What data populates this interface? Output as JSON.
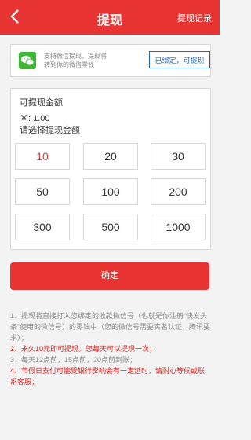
{
  "header": {
    "title": "提现",
    "record_label": "提现记录"
  },
  "wechat": {
    "info_line1": "支持微信提现，提现将",
    "info_line2": "转到你的微信零钱",
    "bound_button": "已绑定，可提现"
  },
  "withdraw": {
    "available_label": "可提现金额",
    "amount": "￥: 1.00",
    "select_label": "请选择提现金额"
  },
  "options": [
    "10",
    "20",
    "30",
    "50",
    "100",
    "200",
    "300",
    "500",
    "1000"
  ],
  "confirm_label": "确定",
  "notes": [
    "1、提现将直接打入您绑定的收款微信号（也就是你注册“快发头条”使用的微信号）的零钱中（您的微信号需要实名认证，腾讯要求）；",
    "2、永久10元即可提现。您每天可以提现一次；",
    "3、每天12点前，15点前，20点前到账；",
    "4、节假日支付可能受银行影响会有一定延时，请耐心等候或联系客服；"
  ],
  "colors": {
    "accent": "#e83432",
    "link": "#1f65c0",
    "wechat_green": "#3fb838"
  }
}
